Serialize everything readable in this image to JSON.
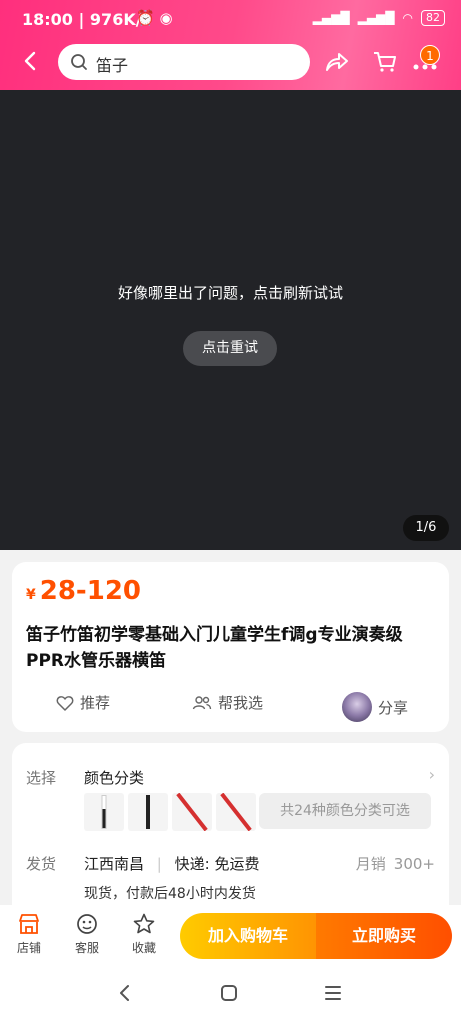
{
  "status": {
    "time": "18:00",
    "speed": "976K/s",
    "battery": "82"
  },
  "search": {
    "value": "笛子"
  },
  "cart_badge": "1",
  "media": {
    "error_msg": "好像哪里出了问题，点击刷新试试",
    "retry_label": "点击重试",
    "pager": "1/6"
  },
  "product": {
    "currency": "¥",
    "price": "28-120",
    "title": "笛子竹笛初学零基础入门儿童学生f调g专业演奏级PPR水管乐器横笛",
    "actions": {
      "recommend": "推荐",
      "help_choose": "帮我选",
      "share": "分享"
    }
  },
  "options": {
    "select_label": "选择",
    "select_value": "颜色分类",
    "more_colors": "共24种颜色分类可选",
    "ship_label": "发货",
    "ship_from": "江西南昌",
    "ship_sep": "|",
    "express": "快递: 免运费",
    "sales_label": "月销",
    "sales_value": "300+",
    "ship_note": "现货，付款后48小时内发货"
  },
  "bottom": {
    "shop": "店铺",
    "service": "客服",
    "favorite": "收藏",
    "add_cart": "加入购物车",
    "buy_now": "立即购买"
  },
  "colors": {
    "accent": "#ff5000",
    "topbar": "#ff3f86"
  }
}
